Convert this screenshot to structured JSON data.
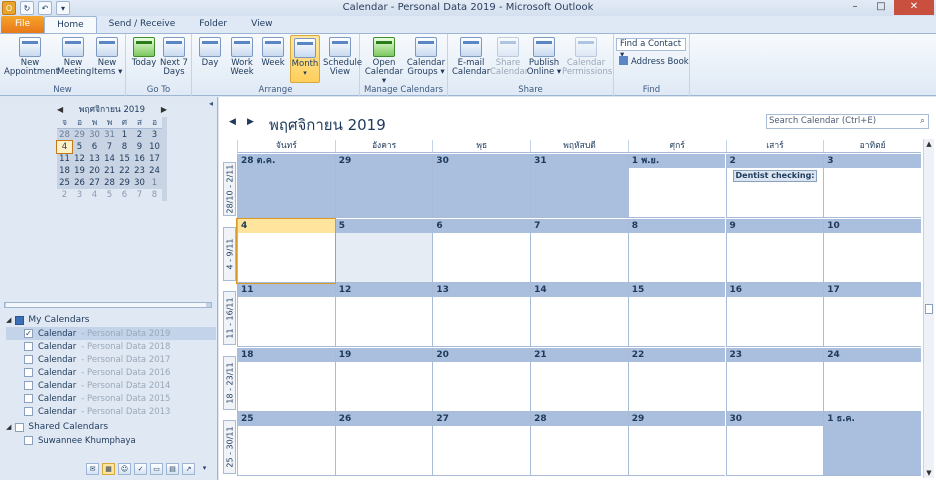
{
  "window": {
    "title": "Calendar - Personal Data 2019  -  Microsoft Outlook",
    "controls": [
      "–",
      "□",
      "✕"
    ]
  },
  "tabs": [
    {
      "label": "File"
    },
    {
      "label": "Home"
    },
    {
      "label": "Send / Receive"
    },
    {
      "label": "Folder"
    },
    {
      "label": "View"
    }
  ],
  "ribbon": {
    "groups": {
      "new": "New",
      "goto": "Go To",
      "arrange": "Arrange",
      "manage": "Manage Calendars",
      "share": "Share",
      "find": "Find"
    },
    "buttons": {
      "new_appointment": "New Appointment",
      "new_meeting": "New Meeting",
      "new_items": "New Items ▾",
      "today": "Today",
      "next7": "Next 7 Days",
      "day": "Day",
      "work_week": "Work Week",
      "week": "Week",
      "month": "Month",
      "schedule_view": "Schedule View",
      "open_calendar": "Open Calendar ▾",
      "calendar_groups": "Calendar Groups ▾",
      "email_calendar": "E-mail Calendar",
      "share_calendar": "Share Calendar",
      "publish_online": "Publish Online ▾",
      "calendar_permissions": "Calendar Permissions"
    },
    "find_contact": "Find a Contact ▾",
    "address_book": "Address Book"
  },
  "minical": {
    "title": "พฤศจิกายน 2019",
    "dow": [
      "จ",
      "อ",
      "พ",
      "พ",
      "ศ",
      "ส",
      "อ"
    ],
    "weeks": [
      [
        "28",
        "29",
        "30",
        "31",
        "1",
        "2",
        "3"
      ],
      [
        "4",
        "5",
        "6",
        "7",
        "8",
        "9",
        "10"
      ],
      [
        "11",
        "12",
        "13",
        "14",
        "15",
        "16",
        "17"
      ],
      [
        "18",
        "19",
        "20",
        "21",
        "22",
        "23",
        "24"
      ],
      [
        "25",
        "26",
        "27",
        "28",
        "29",
        "30",
        "1"
      ],
      [
        "2",
        "3",
        "4",
        "5",
        "6",
        "7",
        "8"
      ]
    ]
  },
  "folders": {
    "my_calendars": "My Calendars",
    "shared_calendars": "Shared Calendars",
    "items": [
      {
        "name": "Calendar",
        "sub": " - Personal Data 2019",
        "checked": true
      },
      {
        "name": "Calendar",
        "sub": " - Personal Data 2018",
        "checked": false
      },
      {
        "name": "Calendar",
        "sub": " - Personal Data 2017",
        "checked": false
      },
      {
        "name": "Calendar",
        "sub": " - Personal Data 2016",
        "checked": false
      },
      {
        "name": "Calendar",
        "sub": " - Personal Data 2014",
        "checked": false
      },
      {
        "name": "Calendar",
        "sub": " - Personal Data 2015",
        "checked": false
      },
      {
        "name": "Calendar",
        "sub": " - Personal Data 2013",
        "checked": false
      }
    ],
    "shared_items": [
      {
        "name": "Suwannee  Khumphaya"
      }
    ]
  },
  "calendar": {
    "month_title": "พฤศจิกายน 2019",
    "search_placeholder": "Search Calendar (Ctrl+E)",
    "dow": [
      "จันทร์",
      "อังคาร",
      "พุธ",
      "พฤหัสบดี",
      "ศุกร์",
      "เสาร์",
      "อาทิตย์"
    ],
    "weeks": [
      {
        "label": "28/10 - 2/11",
        "days": [
          "28 ต.ค.",
          "29",
          "30",
          "31",
          "1 พ.ย.",
          "2",
          "3"
        ]
      },
      {
        "label": "4 - 9/11",
        "days": [
          "4",
          "5",
          "6",
          "7",
          "8",
          "9",
          "10"
        ]
      },
      {
        "label": "11 - 16/11",
        "days": [
          "11",
          "12",
          "13",
          "14",
          "15",
          "16",
          "17"
        ]
      },
      {
        "label": "18 - 23/11",
        "days": [
          "18",
          "19",
          "20",
          "21",
          "22",
          "23",
          "24"
        ]
      },
      {
        "label": "25 - 30/11",
        "days": [
          "25",
          "26",
          "27",
          "28",
          "29",
          "30",
          "1 ธ.ค."
        ]
      }
    ],
    "appointment": "Dentist checking: Sr"
  }
}
